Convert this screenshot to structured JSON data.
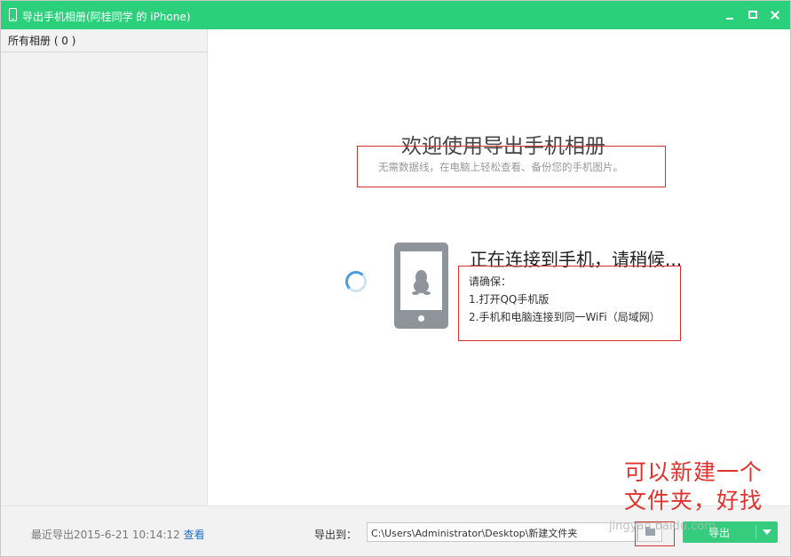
{
  "window": {
    "title": "导出手机相册(阿桂同学 的 iPhone)",
    "icon": "phone-icon",
    "controls": [
      "minimize-icon",
      "maximize-icon",
      "close-icon"
    ]
  },
  "sidebar": {
    "album_all": "所有相册 ( 0 )"
  },
  "main": {
    "welcome_title": "欢迎使用导出手机相册",
    "welcome_subtitle": "无需数据线，在电脑上轻松查看、备份您的手机图片。",
    "connecting_text": "正在连接到手机，请稍候...",
    "ensure_heading": "请确保：",
    "ensure_items": [
      "1.打开QQ手机版",
      "2.手机和电脑连接到同一WiFi（局域网）"
    ]
  },
  "footer": {
    "last_export_text": "最近导出2015-6-21 10:14:12",
    "view_link": "查看",
    "export_to_label": "导出到：",
    "path_value": "C:\\Users\\Administrator\\Desktop\\新建文件夹",
    "export_button": "导出"
  },
  "annotations": {
    "handwritten_lines": [
      "可以新建一个",
      "文件夹，好找"
    ],
    "box_color": "#d3302f"
  },
  "watermark": "jingyan.baidu.com",
  "colors": {
    "titlebar": "#2bd07b",
    "export_button": "#35cc7d",
    "link": "#1f6fc4"
  }
}
